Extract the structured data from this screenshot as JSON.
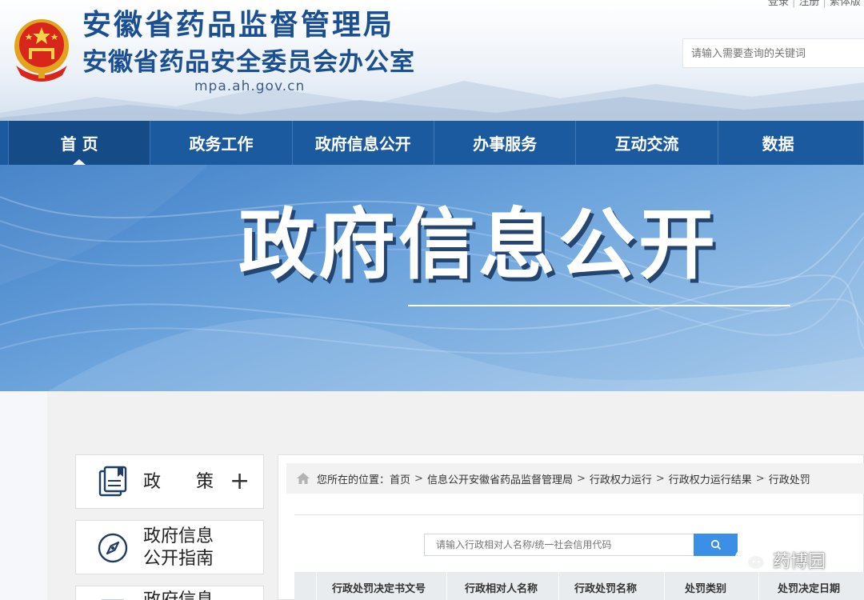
{
  "header": {
    "title": "安徽省药品监督管理局",
    "subtitle": "安徽省药品安全委员会办公室",
    "domain": "mpa.ah.gov.cn",
    "top_links": [
      "登录",
      "注册",
      "繁体版"
    ],
    "search_placeholder": "请输入需要查询的关键词"
  },
  "nav": {
    "items": [
      {
        "label": "首 页",
        "active": true
      },
      {
        "label": "政务工作"
      },
      {
        "label": "政府信息公开"
      },
      {
        "label": "办事服务"
      },
      {
        "label": "互动交流"
      },
      {
        "label": "数据"
      }
    ]
  },
  "banner": {
    "title": "政府信息公开"
  },
  "sidebar": {
    "items": [
      {
        "label": "政　　策",
        "icon": "book-icon",
        "expand": "+"
      },
      {
        "label_line1": "政府信息",
        "label_line2": "公开指南",
        "icon": "compass-icon"
      },
      {
        "label": "政府信息",
        "icon": "list-icon"
      }
    ]
  },
  "breadcrumb": {
    "prefix": "您所在的位置：",
    "items": [
      "首页",
      "信息公开安徽省药品监督管理局",
      "行政权力运行",
      "行政权力运行结果",
      "行政处罚"
    ],
    "separator": ">"
  },
  "query": {
    "placeholder": "请输入行政相对人名称/统一社会信用代码"
  },
  "table": {
    "columns": [
      "行政处罚决定书文号",
      "行政相对人名称",
      "行政处罚名称",
      "处罚类别",
      "处罚决定日期"
    ]
  },
  "watermark": {
    "text": "药博园"
  },
  "colors": {
    "primary": "#1b5a9f",
    "title": "#1a4f94",
    "accent": "#3c8fe6"
  }
}
